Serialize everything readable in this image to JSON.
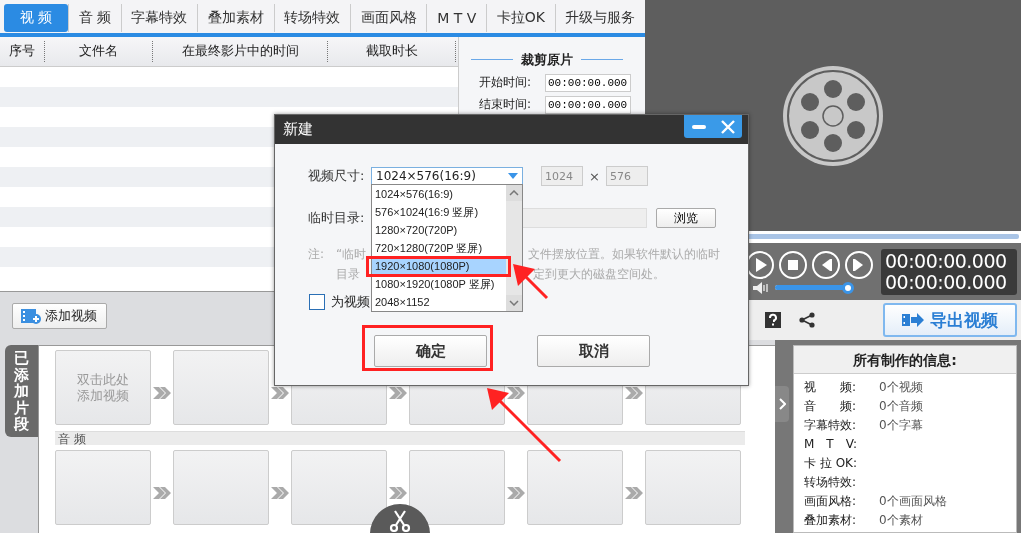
{
  "tabs": [
    {
      "label": "视 频",
      "selected": true
    },
    {
      "label": "音 频",
      "selected": false
    },
    {
      "label": "字幕特效",
      "selected": false
    },
    {
      "label": "叠加素材",
      "selected": false
    },
    {
      "label": "转场特效",
      "selected": false
    },
    {
      "label": "画面风格",
      "selected": false
    },
    {
      "label": "M T V",
      "selected": false
    },
    {
      "label": "卡拉OK",
      "selected": false
    },
    {
      "label": "升级与服务",
      "selected": false
    }
  ],
  "clip_table": {
    "columns": [
      "序号",
      "文件名",
      "在最终影片中的时间",
      "截取时长"
    ]
  },
  "trim_panel": {
    "title": "裁剪原片",
    "fields": [
      {
        "label": "开始时间:",
        "value": "00:00:00.000"
      },
      {
        "label": "结束时间:",
        "value": "00:00:00.000"
      }
    ]
  },
  "player": {
    "times": [
      "00:00:00.000",
      "00:00:00.000"
    ],
    "volume": {
      "level": 0.95
    },
    "export_button": "导出视频"
  },
  "add_video_button": "添加视频",
  "timeline": {
    "side_tab": "已添加片段",
    "video_slots": [
      {
        "kind": "hint",
        "text": "双击此处添加视频"
      },
      {
        "kind": "empty"
      },
      {
        "kind": "empty"
      },
      {
        "kind": "empty"
      },
      {
        "kind": "empty"
      },
      {
        "kind": "empty"
      }
    ],
    "audio_label": "音 频",
    "audio_slots": [
      {
        "kind": "empty"
      },
      {
        "kind": "empty"
      },
      {
        "kind": "empty"
      },
      {
        "kind": "empty"
      },
      {
        "kind": "empty"
      },
      {
        "kind": "empty"
      }
    ]
  },
  "info_panel": {
    "title": "所有制作的信息:",
    "rows": [
      {
        "label": "视　　频:",
        "value": "0个视频"
      },
      {
        "label": "音　　频:",
        "value": "0个音频"
      },
      {
        "label": "字幕特效:",
        "value": "0个字幕"
      },
      {
        "label": "M　T　V:"
      },
      {
        "label": "卡 拉 OK:"
      },
      {
        "label": "转场特效:"
      },
      {
        "label": "画面风格:",
        "value": "0个画面风格"
      },
      {
        "label": "叠加素材:",
        "value": "0个素材"
      }
    ]
  },
  "dialog": {
    "title": "新建",
    "size_label": "视频尺寸:",
    "size_value": "1024×576(16:9)",
    "width_value": "1024",
    "times_sign": "×",
    "height_value": "576",
    "size_options": [
      {
        "label": "1024×576(16:9)",
        "selected": false
      },
      {
        "label": "576×1024(16:9 竖屏)",
        "selected": false
      },
      {
        "label": "1280×720(720P)",
        "selected": false
      },
      {
        "label": "720×1280(720P 竖屏)",
        "selected": false
      },
      {
        "label": "1920×1080(1080P)",
        "selected": true
      },
      {
        "label": "1080×1920(1080P 竖屏)",
        "selected": false
      },
      {
        "label": "2048×1152",
        "selected": false
      }
    ],
    "temp_dir_label": "临时目录:",
    "browse_button": "浏览",
    "note": {
      "prefix": "注:",
      "lines": [
        [
          "“临时",
          "文件摆放位置。如果软件默认的临时"
        ],
        [
          "目录",
          "定到更大的磁盘空间处。"
        ]
      ]
    },
    "auto_checkbox": {
      "label": "为视频",
      "checked": false
    },
    "ok_button": "确定",
    "cancel_button": "取消"
  }
}
